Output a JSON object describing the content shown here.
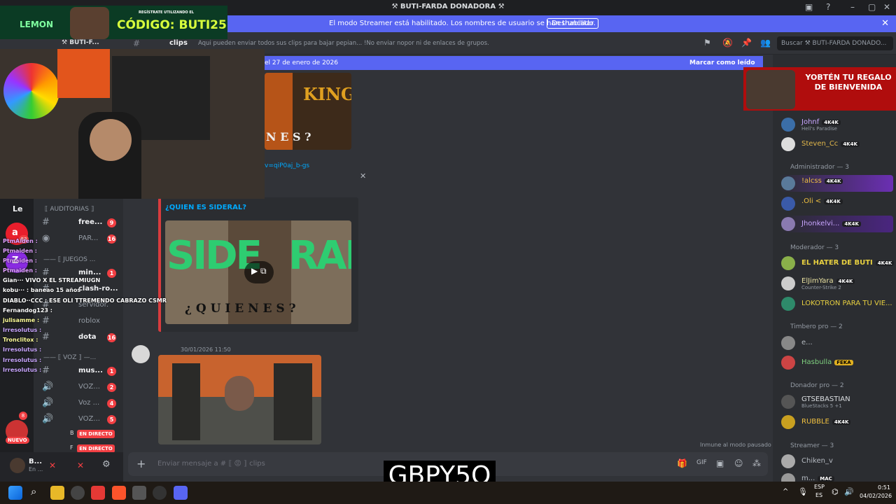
{
  "window": {
    "title": "⚒ BUTI-FARDA DONADORA ⚒"
  },
  "banner": {
    "message": "El modo Streamer está habilitado. Los nombres de usuario se han truncado.",
    "button": "Deshabilitar"
  },
  "header": {
    "server_short": "⚒ BUTI-F...",
    "channel": "clips",
    "topic": "Aqui pueden enviar todos sus clips para bajar pepian... !No enviar nopor ni de enlaces de grupos.",
    "search_placeholder": "Buscar ⚒ BUTI-FARDA DONADO..."
  },
  "newbar": {
    "text": "el 27 de enero de 2026",
    "mark_read": "Marcar como leído"
  },
  "sidebar": {
    "server_letter": "Le",
    "categories": [
      {
        "label": "⟦ AUDITORIAS ⟧"
      },
      {
        "label": "—— ⟦ JUEGOS ..."
      },
      {
        "label": "—— ⟦ VOZ ⟧ —..."
      }
    ],
    "channels": [
      {
        "name": "free...",
        "badge": "9"
      },
      {
        "name": "PAR...",
        "badge": "16"
      },
      {
        "name": "min...",
        "badge": "1"
      },
      {
        "name": "clash-ro...",
        "badge": ""
      },
      {
        "name": "servidor...",
        "badge": ""
      },
      {
        "name": "roblox",
        "badge": ""
      },
      {
        "name": "dota",
        "badge": "16"
      },
      {
        "name": "mus...",
        "badge": "1"
      },
      {
        "name": "VOZ...",
        "badge": "2"
      },
      {
        "name": "Voz ...",
        "badge": "4"
      },
      {
        "name": "VOZ...",
        "badge": "5"
      }
    ],
    "live_label": "EN DIRECTO",
    "live_users": [
      "B",
      "F"
    ],
    "server_badges": [
      "83",
      "8",
      "22",
      "8"
    ],
    "new_label": "NUEVO"
  },
  "user": {
    "name": "B...",
    "status": "En ..."
  },
  "messages": {
    "link_fragment": "v=qiP0aj_b-gs",
    "embed_title": "¿QUIEN ES SIDERAL?",
    "thumb1_text": [
      "KING",
      "N E S ?"
    ],
    "thumb2_text": [
      "SIDE",
      "RAL",
      "¿ Q U I E N   E S ?"
    ],
    "timestamp": "30/01/2026 11:50",
    "muted_note": "Inmune al modo pausado"
  },
  "input": {
    "placeholder": "Enviar mensaje a #  ⟦ 😡 ⟧  clips"
  },
  "members": {
    "groups": [
      {
        "label": "",
        "members": [
          {
            "name": "Johnf",
            "sub": "Hell's Paradise",
            "tag": "4K4K"
          },
          {
            "name": "Steven_Cc",
            "sub": "",
            "tag": "4K4K"
          }
        ]
      },
      {
        "label": "Administrador — 3",
        "members": [
          {
            "name": "!alcss",
            "sub": "",
            "tag": "4K4K"
          },
          {
            "name": ".Oli <",
            "sub": "",
            "tag": "4K4K"
          },
          {
            "name": "Jhonkelvi...",
            "sub": "",
            "tag": "4K4K"
          }
        ]
      },
      {
        "label": "Moderador — 3",
        "members": [
          {
            "name": "EL HATER DE BUTI",
            "sub": "",
            "tag": "4K4K"
          },
          {
            "name": "ElJimYara",
            "sub": "Counter-Strike 2",
            "tag": "4K4K"
          },
          {
            "name": "LOKOTRON PARA TU VIE...",
            "sub": "",
            "tag": ""
          }
        ]
      },
      {
        "label": "Timbero pro — 2",
        "members": [
          {
            "name": "e...",
            "sub": "",
            "tag": ""
          },
          {
            "name": "Hasbulla",
            "sub": "",
            "tag": "FEKA"
          }
        ]
      },
      {
        "label": "Donador pro — 2",
        "members": [
          {
            "name": "GTSEBASTIAN",
            "sub": "BlueStacks 5 +1",
            "tag": ""
          },
          {
            "name": "RUBBLE",
            "sub": "",
            "tag": "4K4K"
          }
        ]
      },
      {
        "label": "Streamer — 3",
        "members": [
          {
            "name": "Chiken_v",
            "sub": "",
            "tag": ""
          },
          {
            "name": "m...",
            "sub": "",
            "tag": "MAC"
          }
        ]
      }
    ]
  },
  "overlay": {
    "lemon_brand": "LEMON",
    "lemon_small": "REGÍSTRATE UTILIZANDO EL",
    "lemon_code": "CÓDIGO: BUTI25",
    "promo": "YOBTÉN TU REGALO DE BIENVENIDA",
    "code": "GBPY5O",
    "chat": [
      "PtmAiden :",
      "Ptmaiden :",
      "Ptmaiden :",
      "Ptmaiden :",
      "Gian··· VIVO X EL STREAMIUGN",
      "kobu··· : baneao 15 años",
      "DIABLO··CCC : ESE OLI TTREMENDO CABRAZO CSMR",
      "Fernandog123 :",
      "julisamme :",
      "Irresolutus :",
      "Tronclitox :",
      "Irresolutus :",
      "Irresolutus :",
      "Irresolutus :"
    ]
  },
  "taskbar": {
    "lang1": "ESP",
    "lang2": "ES",
    "time": "0:51",
    "date": "04/02/2026"
  },
  "colors": {
    "blurple": "#5865f2",
    "red": "#f23f43",
    "bg": "#313338",
    "panel": "#2b2d31"
  }
}
